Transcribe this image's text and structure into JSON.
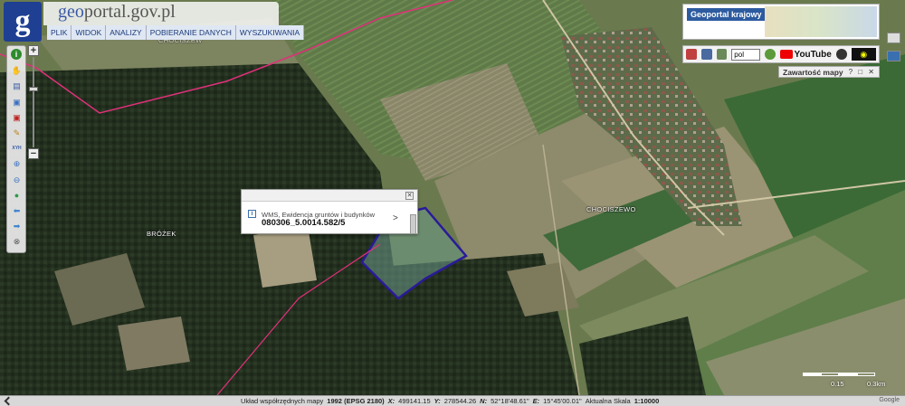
{
  "header": {
    "logo_letter": "g",
    "brand_prefix": "geo",
    "brand_suffix": "portal.gov.pl",
    "menu": [
      "PLIK",
      "WIDOK",
      "ANALIZY",
      "POBIERANIE DANYCH",
      "WYSZUKIWANIA"
    ]
  },
  "toolbar": {
    "tools": [
      {
        "name": "info-icon",
        "glyph": "i",
        "color": "#2e8b2e"
      },
      {
        "name": "pan-hand-icon",
        "glyph": "✋",
        "color": "#c07020"
      },
      {
        "name": "document-icon",
        "glyph": "▤",
        "color": "#3a5aa8"
      },
      {
        "name": "add-layer-icon",
        "glyph": "▣",
        "color": "#3a70c0"
      },
      {
        "name": "remove-layer-icon",
        "glyph": "▣",
        "color": "#c02020"
      },
      {
        "name": "pencil-icon",
        "glyph": "✎",
        "color": "#c08020"
      },
      {
        "name": "xyh-icon",
        "glyph": "XYH",
        "color": "#3a5aa8"
      },
      {
        "name": "zoom-in-icon",
        "glyph": "⊕",
        "color": "#3a70c0"
      },
      {
        "name": "zoom-out-icon",
        "glyph": "⊖",
        "color": "#3a70c0"
      },
      {
        "name": "globe-icon",
        "glyph": "●",
        "color": "#2e9a4a"
      },
      {
        "name": "back-arrow-icon",
        "glyph": "⬅",
        "color": "#3a80d0"
      },
      {
        "name": "forward-arrow-icon",
        "glyph": "➡",
        "color": "#3a80d0"
      },
      {
        "name": "compass-icon",
        "glyph": "⊗",
        "color": "#555555"
      }
    ]
  },
  "zoom": {
    "plus": "+",
    "minus": "−"
  },
  "right_panel": {
    "geoportal_krajowy": "Geoportal krajowy",
    "language": "pol",
    "youtube": "YouTube",
    "contents_title": "Zawartość mapy",
    "contents_controls": "? □ ✕"
  },
  "popup": {
    "close": "✕",
    "info": "i",
    "layer": "WMS, Ewidencja gruntów i budynków",
    "value": "080306_5.0014.582/5",
    "arrow": ">"
  },
  "map_labels": {
    "brozek": "BRÓŻEK",
    "chociszewo": "CHOCISZEWO",
    "top_left": "CHOCISZEW"
  },
  "scale": {
    "left": "0.15",
    "right": "0.3km"
  },
  "status": {
    "prefix": "Układ współrzędnych mapy",
    "crs": "1992 (EPSG 2180)",
    "x_label": "X:",
    "x_value": "499141.15",
    "y_label": "Y:",
    "y_value": "278544.26",
    "n_label": "N:",
    "n_value": "52°18'48.61\"",
    "e_label": "E:",
    "e_value": "15°45'00.01\"",
    "scale_label": "Aktualna Skala",
    "scale_value": "1:10000",
    "right_text": "Google"
  },
  "colors": {
    "brand_blue": "#1f3f92",
    "boundary_magenta": "#e0307a",
    "parcel_outline": "#2a1a9a"
  }
}
